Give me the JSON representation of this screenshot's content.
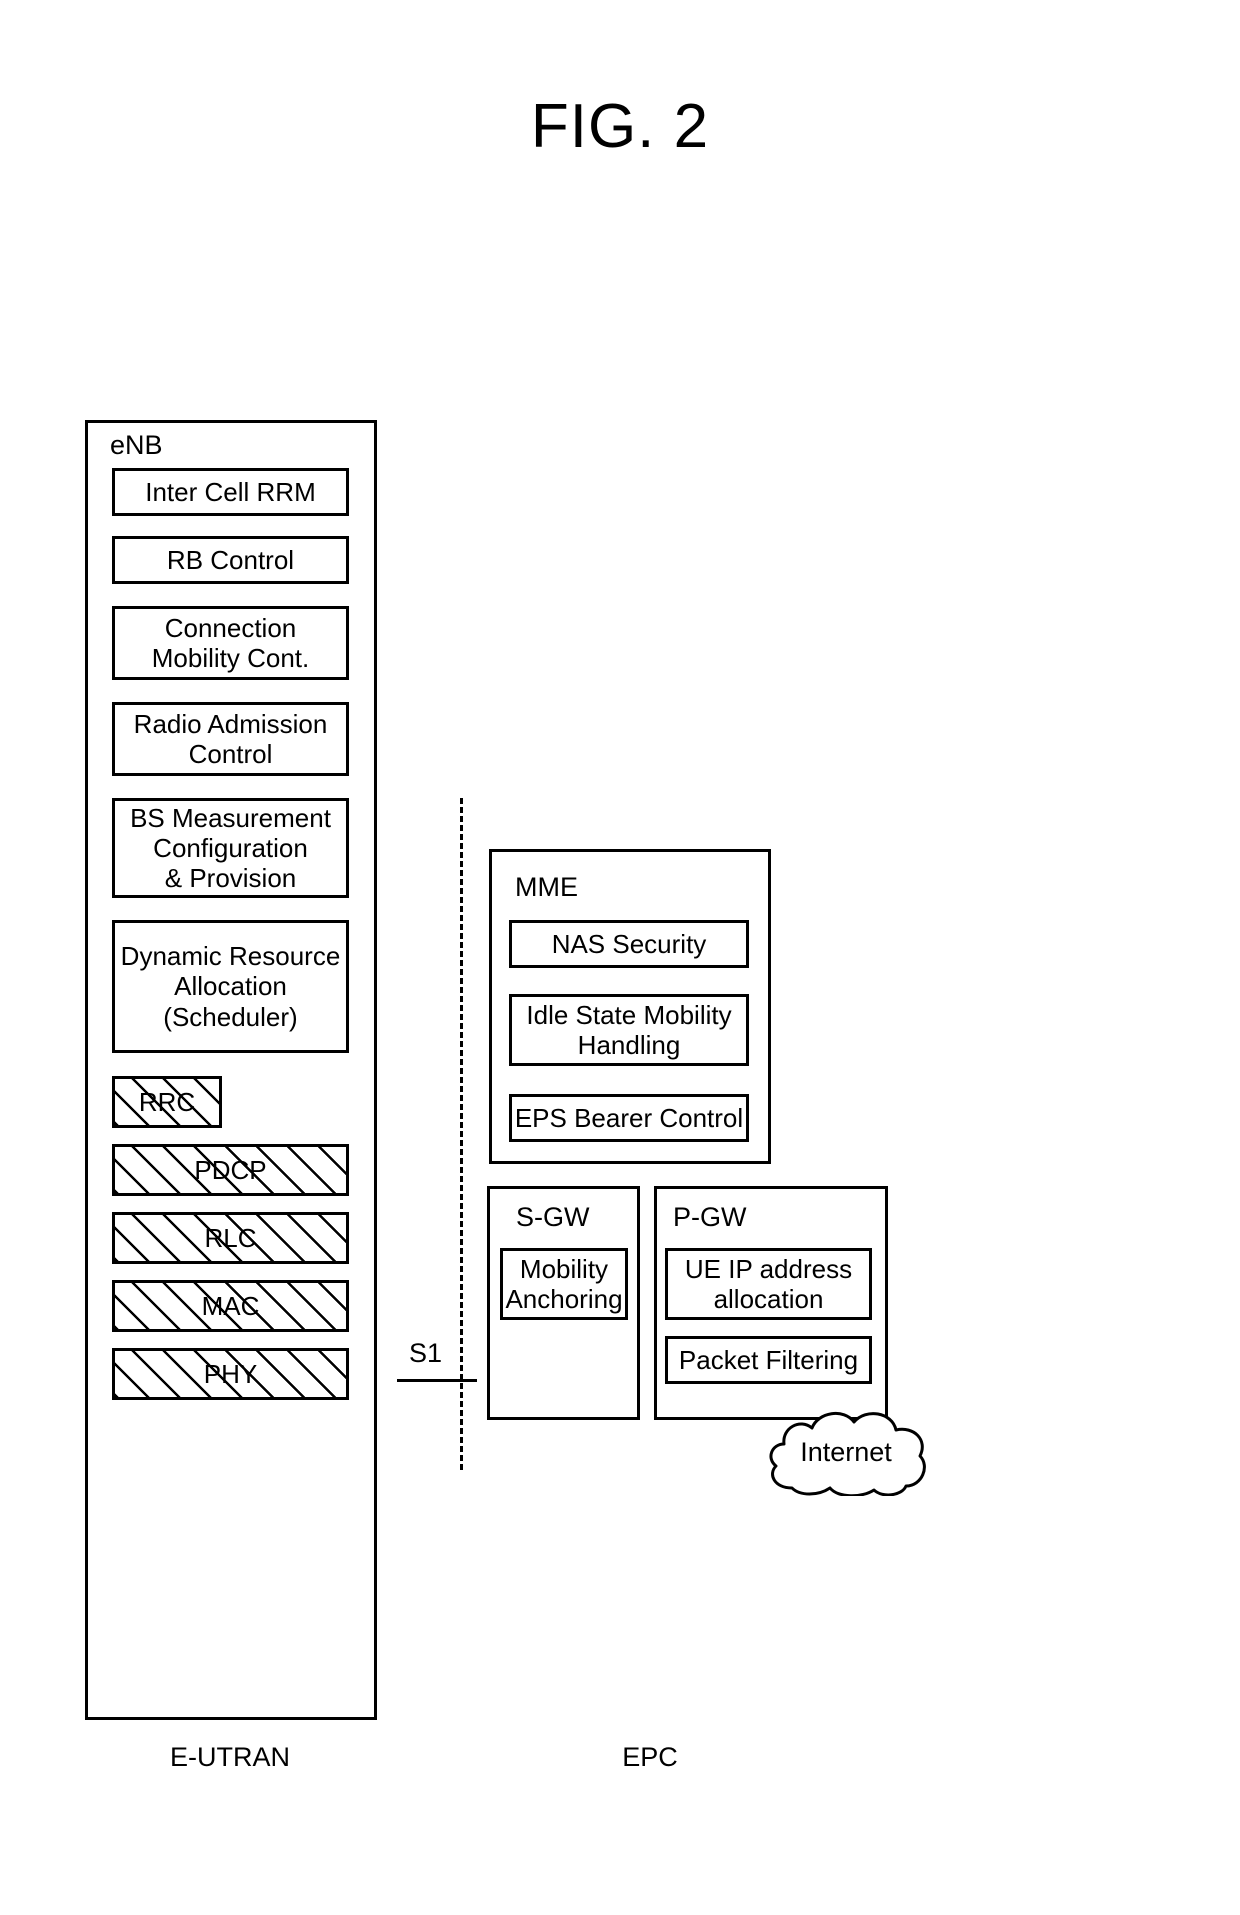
{
  "figure": {
    "title": "FIG. 2",
    "type": "lte-eps-architecture-functional-split-diagram"
  },
  "enb": {
    "label": "eNB",
    "function_blocks": [
      {
        "label": "Inter Cell RRM"
      },
      {
        "label": "RB Control"
      },
      {
        "label": "Connection\nMobility Cont."
      },
      {
        "label": "Radio Admission\nControl"
      },
      {
        "label": "BS Measurement\nConfiguration\n& Provision"
      },
      {
        "label": "Dynamic Resource\nAllocation\n(Scheduler)"
      }
    ],
    "protocol_layers": [
      {
        "label": "RRC",
        "hatched": true
      },
      {
        "label": "PDCP",
        "hatched": true
      },
      {
        "label": "RLC",
        "hatched": true
      },
      {
        "label": "MAC",
        "hatched": true
      },
      {
        "label": "PHY",
        "hatched": true
      }
    ]
  },
  "interface": {
    "label": "S1"
  },
  "mme": {
    "label": "MME",
    "blocks": [
      {
        "label": "NAS Security"
      },
      {
        "label": "Idle State Mobility\nHandling"
      },
      {
        "label": "EPS Bearer Control"
      }
    ]
  },
  "sgw": {
    "label": "S-GW",
    "blocks": [
      {
        "label": "Mobility\nAnchoring"
      }
    ]
  },
  "pgw": {
    "label": "P-GW",
    "blocks": [
      {
        "label": "UE IP address\nallocation"
      },
      {
        "label": "Packet Filtering"
      }
    ]
  },
  "internet": {
    "label": "Internet"
  },
  "captions": {
    "left": "E-UTRAN",
    "right": "EPC"
  },
  "colors": {
    "stroke": "#000000",
    "background": "#ffffff"
  }
}
